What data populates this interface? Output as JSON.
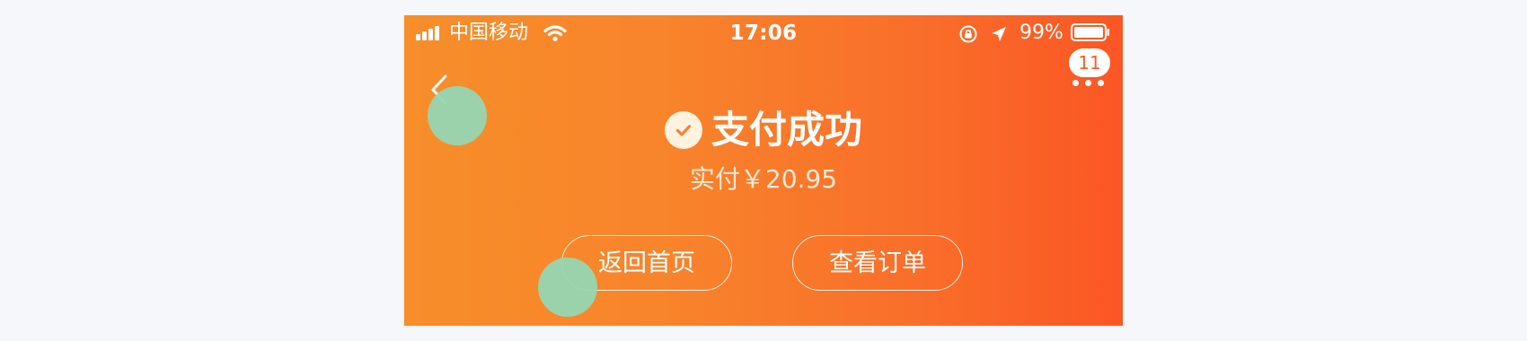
{
  "status_bar": {
    "carrier": "中国移动",
    "time": "17:06",
    "battery_percent": "99%",
    "icons": [
      "signal-icon",
      "wifi-icon",
      "orientation-lock-icon",
      "location-icon",
      "battery-icon"
    ]
  },
  "nav": {
    "back_icon": "chevron-left-icon",
    "more_icon": "more-dots-icon",
    "badge_count": "11"
  },
  "payment": {
    "status_icon": "check-circle-icon",
    "title": "支付成功",
    "amount": "实付￥20.95"
  },
  "actions": {
    "home_button": "返回首页",
    "orders_button": "查看订单"
  },
  "colors": {
    "gradient_start": "#f78e2a",
    "gradient_end": "#fb5624",
    "accent": "#ff5a2d",
    "touch_indicator": "#96d6b3"
  }
}
